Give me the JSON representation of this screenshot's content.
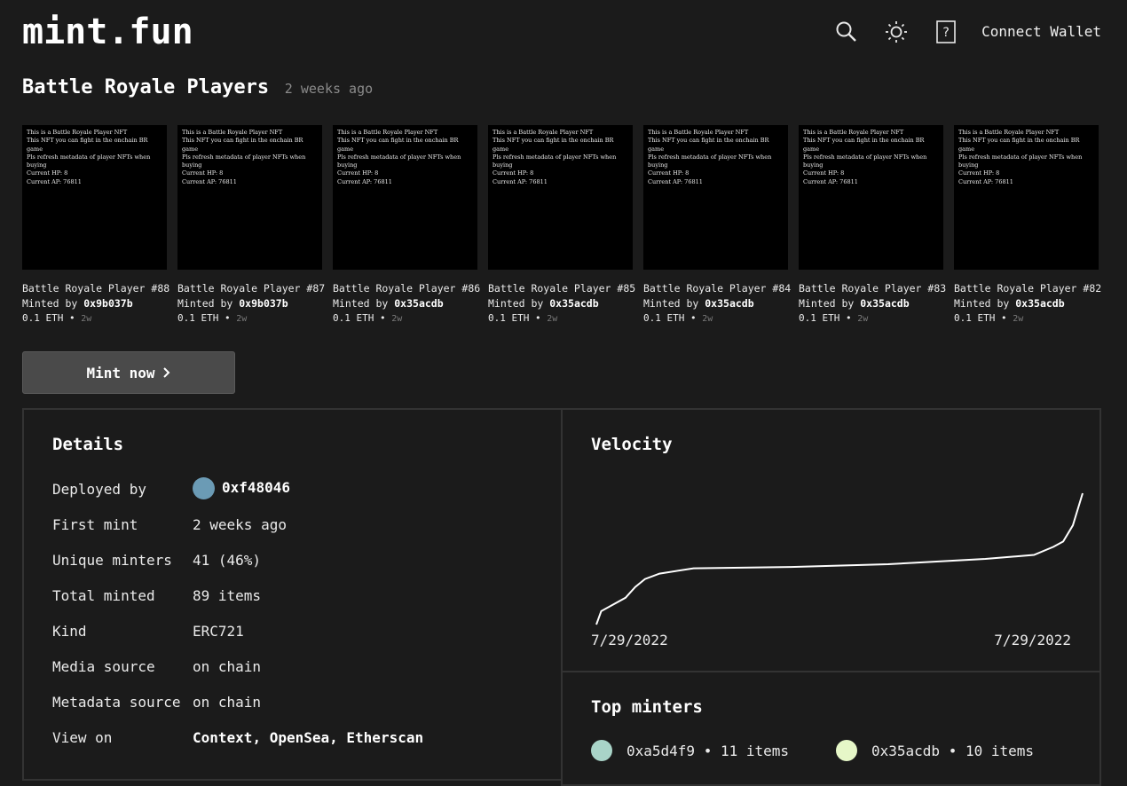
{
  "header": {
    "logo": "mint.fun",
    "connect_label": "Connect Wallet",
    "icons": [
      "search-icon",
      "sun-icon",
      "help-icon"
    ]
  },
  "collection": {
    "title": "Battle Royale Players",
    "age": "2 weeks ago"
  },
  "card_description": [
    "This is a Battle Royale Player NFT",
    "This NFT you can fight in the onchain BR game",
    "Pls refresh metadata of player NFTs when buying",
    "Current HP: 8",
    "Current AP: 76811"
  ],
  "cards": [
    {
      "name": "Battle Royale Player #88",
      "minted_prefix": "Minted by",
      "minter": "0x9b037b",
      "price": "0.1 ETH",
      "age": "2w"
    },
    {
      "name": "Battle Royale Player #87",
      "minted_prefix": "Minted by",
      "minter": "0x9b037b",
      "price": "0.1 ETH",
      "age": "2w"
    },
    {
      "name": "Battle Royale Player #86",
      "minted_prefix": "Minted by",
      "minter": "0x35acdb",
      "price": "0.1 ETH",
      "age": "2w"
    },
    {
      "name": "Battle Royale Player #85",
      "minted_prefix": "Minted by",
      "minter": "0x35acdb",
      "price": "0.1 ETH",
      "age": "2w"
    },
    {
      "name": "Battle Royale Player #84",
      "minted_prefix": "Minted by",
      "minter": "0x35acdb",
      "price": "0.1 ETH",
      "age": "2w"
    },
    {
      "name": "Battle Royale Player #83",
      "minted_prefix": "Minted by",
      "minter": "0x35acdb",
      "price": "0.1 ETH",
      "age": "2w"
    },
    {
      "name": "Battle Royale Player #82",
      "minted_prefix": "Minted by",
      "minter": "0x35acdb",
      "price": "0.1 ETH",
      "age": "2w"
    }
  ],
  "mint_button": {
    "label": "Mint now",
    "icon": "chevron-right-icon"
  },
  "details": {
    "title": "Details",
    "deployed_by_label": "Deployed by",
    "deployed_by_value": "0xf48046",
    "first_mint_label": "First mint",
    "first_mint_value": "2 weeks ago",
    "unique_minters_label": "Unique minters",
    "unique_minters_value": "41 (46%)",
    "total_minted_label": "Total minted",
    "total_minted_value": "89 items",
    "kind_label": "Kind",
    "kind_value": "ERC721",
    "media_source_label": "Media source",
    "media_source_value": "on chain",
    "metadata_source_label": "Metadata source",
    "metadata_source_value": "on chain",
    "view_on_label": "View on",
    "view_on_links": [
      "Context",
      "OpenSea",
      "Etherscan"
    ],
    "avatar_color": "#6b9bb5"
  },
  "velocity": {
    "title": "Velocity",
    "start_date": "7/29/2022",
    "end_date": "7/29/2022"
  },
  "chart_data": {
    "type": "line",
    "title": "Velocity",
    "xlabel": "",
    "ylabel": "",
    "x_tick_labels": [
      "7/29/2022",
      "7/29/2022"
    ],
    "series": [
      {
        "x": [
          0,
          0.01,
          0.03,
          0.06,
          0.08,
          0.1,
          0.13,
          0.2,
          0.4,
          0.6,
          0.8,
          0.9,
          0.94,
          0.96,
          0.98,
          1.0
        ],
        "values": [
          0,
          10,
          14,
          20,
          28,
          34,
          38,
          42,
          43,
          45,
          49,
          52,
          58,
          62,
          74,
          98
        ]
      }
    ],
    "grid": false,
    "legend": "none"
  },
  "top_minters": {
    "title": "Top minters",
    "items": [
      {
        "address": "0xa5d4f9",
        "count": "11 items",
        "color": "#a9d4c8"
      },
      {
        "address": "0x35acdb",
        "count": "10 items",
        "color": "#e6f7c8"
      }
    ]
  }
}
